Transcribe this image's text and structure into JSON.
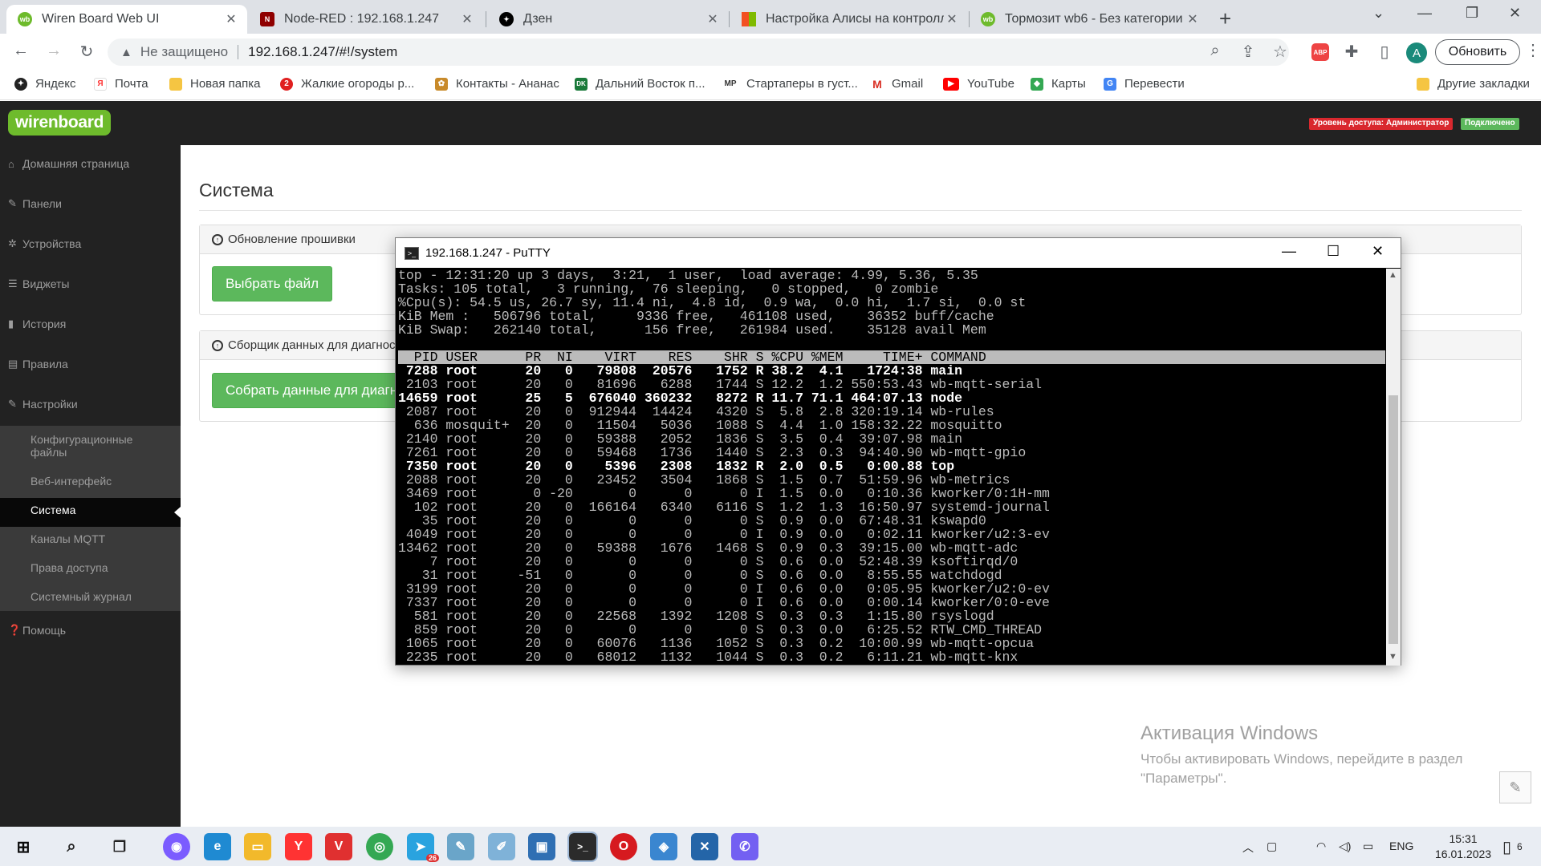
{
  "browser": {
    "tabs": [
      {
        "title": "Wiren Board Web UI",
        "icon": "wirenboard-icon",
        "color": "#6ebb2c",
        "active": true
      },
      {
        "title": "Node-RED : 192.168.1.247",
        "icon": "nodered-icon",
        "color": "#8f0000",
        "active": false
      },
      {
        "title": "Дзен",
        "icon": "dzen-icon",
        "color": "#000000",
        "active": false
      },
      {
        "title": "Настройка Алисы на контролле",
        "icon": "microsoft-icon",
        "color": "#f25022",
        "active": false
      },
      {
        "title": "Тормозит wb6 - Без категории",
        "icon": "wirenboard-icon",
        "color": "#6ebb2c",
        "active": false
      }
    ],
    "address": {
      "insecure_label": "Не защищено",
      "url": "192.168.1.247/#!/system"
    },
    "update_button": "Обновить",
    "profile_initial": "A",
    "abp_label": "ABP",
    "bookmarks": [
      {
        "label": "Яндекс",
        "icon": "yandex-icon",
        "color": "#222222"
      },
      {
        "label": "Почта",
        "icon": "yandex-mail-icon",
        "color": "#ff3333"
      },
      {
        "label": "Новая папка",
        "icon": "folder-icon",
        "color": "#f5c542"
      },
      {
        "label": "Жалкие огороды р...",
        "icon": "zhalkie-icon",
        "color": "#e02020"
      },
      {
        "label": "Контакты - Ананас",
        "icon": "pineapple-icon",
        "color": "#c88a2a"
      },
      {
        "label": "Дальний Восток п...",
        "icon": "dk-icon",
        "color": "#1a7a3a"
      },
      {
        "label": "Стартаперы в густ...",
        "icon": "mp-icon",
        "color": "#333333"
      },
      {
        "label": "Gmail",
        "icon": "gmail-icon",
        "color": "#d93025"
      },
      {
        "label": "YouTube",
        "icon": "youtube-icon",
        "color": "#ff0000"
      },
      {
        "label": "Карты",
        "icon": "maps-icon",
        "color": "#34a853"
      },
      {
        "label": "Перевести",
        "icon": "translate-icon",
        "color": "#4285f4"
      }
    ],
    "other_bookmarks": "Другие закладки"
  },
  "app": {
    "logo": "wirenboard",
    "access_badge": "Уровень доступа: Администратор",
    "connected_badge": "Подключено",
    "colors": {
      "brand": "#6ebb2c",
      "access": "#d9282e",
      "connected": "#5cb85c",
      "sidebar": "#222222"
    },
    "nav": [
      {
        "label": "Домашняя страница",
        "icon": "home-icon"
      },
      {
        "label": "Панели",
        "icon": "wrench-icon"
      },
      {
        "label": "Устройства",
        "icon": "gear-icon"
      },
      {
        "label": "Виджеты",
        "icon": "list-icon"
      },
      {
        "label": "История",
        "icon": "bar-chart-icon"
      },
      {
        "label": "Правила",
        "icon": "file-icon"
      },
      {
        "label": "Настройки",
        "icon": "wrench-icon"
      }
    ],
    "subnav": [
      "Конфигурационные файлы",
      "Веб-интерфейс",
      "Система",
      "Каналы MQTT",
      "Права доступа",
      "Системный журнал"
    ],
    "help": "Помощь",
    "page_title": "Система",
    "firmware_panel": "Обновление прошивки",
    "choose_file": "Выбрать файл",
    "diag_panel": "Сборщик данных для диагностики",
    "collect_button": "Собрать данные для диагностики"
  },
  "activation": {
    "title": "Активация Windows",
    "line1": "Чтобы активировать Windows, перейдите в раздел",
    "line2": "\"Параметры\"."
  },
  "putty": {
    "title": "192.168.1.247 - PuTTY",
    "summary": [
      "top - 12:31:20 up 3 days,  3:21,  1 user,  load average: 4.99, 5.36, 5.35",
      "Tasks: 105 total,   3 running,  76 sleeping,   0 stopped,   0 zombie",
      "%Cpu(s): 54.5 us, 26.7 sy, 11.4 ni,  4.8 id,  0.9 wa,  0.0 hi,  1.7 si,  0.0 st",
      "KiB Mem :   506796 total,     9336 free,   461108 used,    36352 buff/cache",
      "KiB Swap:   262140 total,      156 free,   261984 used.    35128 avail Mem",
      ""
    ],
    "header": "  PID USER      PR  NI    VIRT    RES    SHR S %CPU %MEM     TIME+ COMMAND",
    "processes": [
      {
        "line": " 7288 root      20   0   79808  20576   1752 R 38.2  4.1   1724:38 main",
        "bold": true
      },
      {
        "line": " 2103 root      20   0   81696   6288   1744 S 12.2  1.2 550:53.43 wb-mqtt-serial",
        "bold": false
      },
      {
        "line": "14659 root      25   5  676040 360232   8272 R 11.7 71.1 464:07.13 node",
        "bold": true
      },
      {
        "line": " 2087 root      20   0  912944  14424   4320 S  5.8  2.8 320:19.14 wb-rules",
        "bold": false
      },
      {
        "line": "  636 mosquit+  20   0   11504   5036   1088 S  4.4  1.0 158:32.22 mosquitto",
        "bold": false
      },
      {
        "line": " 2140 root      20   0   59388   2052   1836 S  3.5  0.4  39:07.98 main",
        "bold": false
      },
      {
        "line": " 7261 root      20   0   59468   1736   1440 S  2.3  0.3  94:40.90 wb-mqtt-gpio",
        "bold": false
      },
      {
        "line": " 7350 root      20   0    5396   2308   1832 R  2.0  0.5   0:00.88 top",
        "bold": true
      },
      {
        "line": " 2088 root      20   0   23452   3504   1868 S  1.5  0.7  51:59.96 wb-metrics",
        "bold": false
      },
      {
        "line": " 3469 root       0 -20       0      0      0 I  1.5  0.0   0:10.36 kworker/0:1H-mm",
        "bold": false
      },
      {
        "line": "  102 root      20   0  166164   6340   6116 S  1.2  1.3  16:50.97 systemd-journal",
        "bold": false
      },
      {
        "line": "   35 root      20   0       0      0      0 S  0.9  0.0  67:48.31 kswapd0",
        "bold": false
      },
      {
        "line": " 4049 root      20   0       0      0      0 I  0.9  0.0   0:02.11 kworker/u2:3-ev",
        "bold": false
      },
      {
        "line": "13462 root      20   0   59388   1676   1468 S  0.9  0.3  39:15.00 wb-mqtt-adc",
        "bold": false
      },
      {
        "line": "    7 root      20   0       0      0      0 S  0.6  0.0  52:48.39 ksoftirqd/0",
        "bold": false
      },
      {
        "line": "   31 root     -51   0       0      0      0 S  0.6  0.0   8:55.55 watchdogd",
        "bold": false
      },
      {
        "line": " 3199 root      20   0       0      0      0 I  0.6  0.0   0:05.95 kworker/u2:0-ev",
        "bold": false
      },
      {
        "line": " 7337 root      20   0       0      0      0 I  0.6  0.0   0:00.14 kworker/0:0-eve",
        "bold": false
      },
      {
        "line": "  581 root      20   0   22568   1392   1208 S  0.3  0.3   1:15.80 rsyslogd",
        "bold": false
      },
      {
        "line": "  859 root      20   0       0      0      0 S  0.3  0.0   6:25.52 RTW_CMD_THREAD",
        "bold": false
      },
      {
        "line": " 1065 root      20   0   60076   1136   1052 S  0.3  0.2  10:00.99 wb-mqtt-opcua",
        "bold": false
      },
      {
        "line": " 2235 root      20   0   68012   1132   1044 S  0.3  0.2   6:11.21 wb-mqtt-knx",
        "bold": false
      }
    ]
  },
  "taskbar": {
    "apps": [
      {
        "name": "alice-icon",
        "color": "#7b5cff",
        "glyph": "◉"
      },
      {
        "name": "edge-icon",
        "color": "#1f8ad2",
        "glyph": "e"
      },
      {
        "name": "explorer-icon",
        "color": "#f2b92b",
        "glyph": "▭"
      },
      {
        "name": "yandex-browser-icon",
        "color": "#ff3333",
        "glyph": "Y"
      },
      {
        "name": "vk-icon",
        "color": "#e03030",
        "glyph": "V"
      },
      {
        "name": "chrome-icon",
        "color": "#34a853",
        "glyph": "◎"
      },
      {
        "name": "telegram-icon",
        "color": "#2aa3df",
        "glyph": "➤"
      },
      {
        "name": "notepad-icon",
        "color": "#6aa5c9",
        "glyph": "✎"
      },
      {
        "name": "paint-icon",
        "color": "#7fb2d8",
        "glyph": "✐"
      },
      {
        "name": "rdp-icon",
        "color": "#2f6fb3",
        "glyph": "▣"
      },
      {
        "name": "putty-icon",
        "color": "#2b2b2b",
        "glyph": ">_"
      },
      {
        "name": "opera-icon",
        "color": "#d61a1f",
        "glyph": "O"
      },
      {
        "name": "network-icon",
        "color": "#3a86d0",
        "glyph": "◈"
      },
      {
        "name": "tools-icon",
        "color": "#2465a8",
        "glyph": "✕"
      },
      {
        "name": "viber-icon",
        "color": "#7360f2",
        "glyph": "✆"
      }
    ],
    "telegram_badge": "26",
    "lang": "ENG",
    "time": "15:31",
    "date": "16.01.2023",
    "notifications": "6"
  }
}
